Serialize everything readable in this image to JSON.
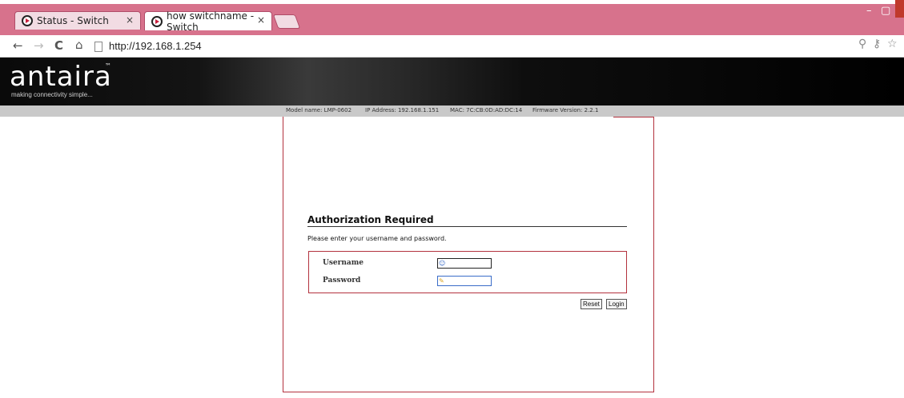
{
  "browser": {
    "tabs": [
      {
        "title": "Status - Switch",
        "close": "×"
      },
      {
        "title": "how switchname - Switch",
        "close": "×"
      }
    ],
    "window_controls": {
      "minimize": "–",
      "restore": "▢"
    },
    "nav": {
      "back": "←",
      "forward": "→",
      "reload": "C",
      "home": "⌂"
    },
    "url": "http://192.168.1.254",
    "toolbar_icons": {
      "search": "⚲",
      "key": "⚷",
      "star": "☆"
    }
  },
  "header": {
    "brand": "antaira",
    "trademark": "™",
    "tagline": "making connectivity simple..."
  },
  "infobar": {
    "model": "Model name: LMP-0602",
    "ip": "IP Address: 192.168.1.151",
    "mac": "MAC: 7C:CB:0D:AD:DC:14",
    "firmware": "Firmware Version: 2.2.1"
  },
  "auth": {
    "title": "Authorization Required",
    "description": "Please enter your username and password.",
    "username_label": "Username",
    "password_label": "Password",
    "username_value": "",
    "password_value": "",
    "reset_label": "Reset",
    "login_label": "Login"
  },
  "colors": {
    "tabbar": "#d7728c",
    "accent_border": "#b3323e",
    "header_bg": "#000000"
  }
}
